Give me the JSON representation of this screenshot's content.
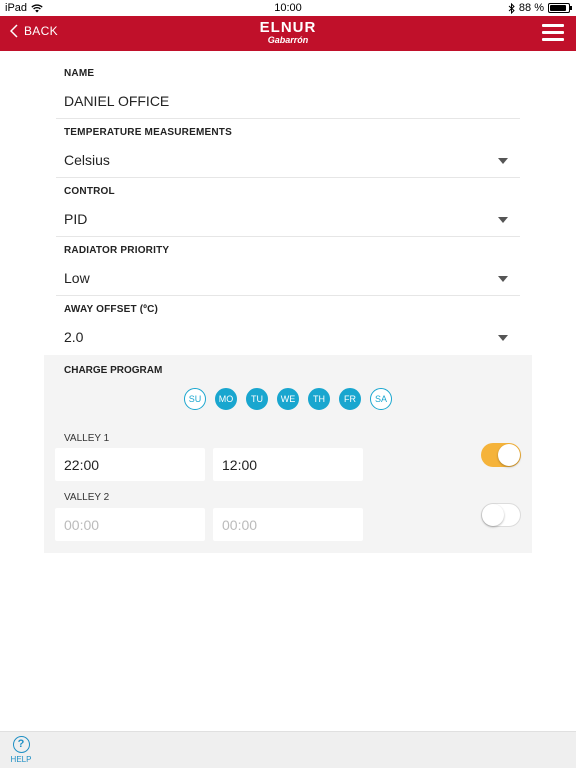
{
  "status_bar": {
    "device": "iPad",
    "time": "10:00",
    "battery": "88 %",
    "battery_level": 0.88
  },
  "nav": {
    "back_label": "BACK",
    "logo_brand": "ELNUR",
    "logo_sub": "Gabarrón"
  },
  "fields": [
    {
      "label": "NAME",
      "value": "DANIEL OFFICE",
      "dropdown": false
    },
    {
      "label": "TEMPERATURE MEASUREMENTS",
      "value": "Celsius",
      "dropdown": true
    },
    {
      "label": "CONTROL",
      "value": "PID",
      "dropdown": true
    },
    {
      "label": "RADIATOR PRIORITY",
      "value": "Low",
      "dropdown": true
    },
    {
      "label": "AWAY OFFSET (ºC)",
      "value": "2.0",
      "dropdown": true
    }
  ],
  "charge_program": {
    "title": "CHARGE PROGRAM",
    "days": [
      {
        "label": "SU",
        "active": false
      },
      {
        "label": "MO",
        "active": true
      },
      {
        "label": "TU",
        "active": true
      },
      {
        "label": "WE",
        "active": true
      },
      {
        "label": "TH",
        "active": true
      },
      {
        "label": "FR",
        "active": true
      },
      {
        "label": "SA",
        "active": false
      }
    ],
    "valleys": [
      {
        "label": "VALLEY 1",
        "start": "22:00",
        "end": "12:00",
        "enabled": true
      },
      {
        "label": "VALLEY 2",
        "start": "00:00",
        "end": "00:00",
        "enabled": false
      }
    ]
  },
  "footer": {
    "help_label": "HELP"
  },
  "colors": {
    "nav": "#c0102a",
    "accent": "#19a6cf",
    "toggle_on": "#f5b33a"
  }
}
